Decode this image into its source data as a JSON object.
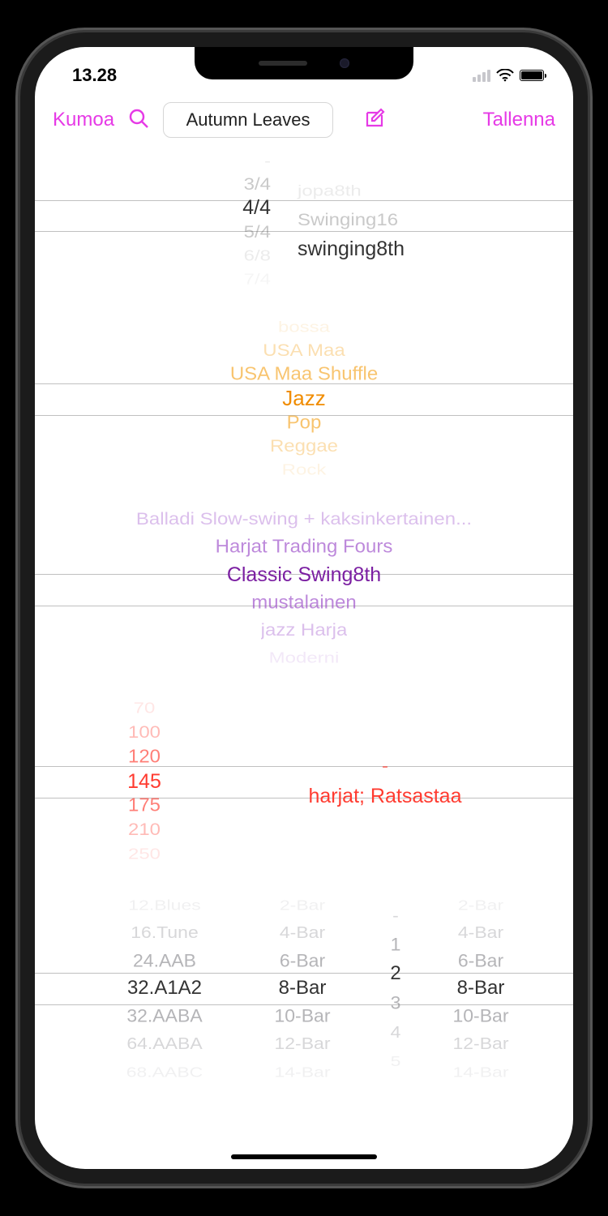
{
  "statusbar": {
    "time": "13.28"
  },
  "toolbar": {
    "cancel": "Kumoa",
    "title": "Autumn Leaves",
    "save": "Tallenna"
  },
  "picker1": {
    "col1": {
      "a3": "-",
      "a2": "3/4",
      "sel": "4/4",
      "b1": "5/4",
      "b2": "6/8",
      "b3": "7/4"
    },
    "col2": {
      "a3": "jopa8th",
      "a2": "Swinging16",
      "sel": "swinging8th"
    }
  },
  "picker2": {
    "a3": "bossa",
    "a2": "USA Maa",
    "a1": "USA Maa Shuffle",
    "sel": "Jazz",
    "b1": "Pop",
    "b2": "Reggae",
    "b3": "Rock"
  },
  "picker3": {
    "a2": "Balladi Slow-swing + kaksinkertainen...",
    "a1": "Harjat Trading Fours",
    "sel": "Classic Swing8th",
    "b1": "mustalainen",
    "b2": "jazz Harja",
    "b3": "Moderni"
  },
  "picker4": {
    "col1": {
      "a3": "70",
      "a2": "100",
      "a1": "120",
      "sel": "145",
      "b1": "175",
      "b2": "210",
      "b3": "250"
    },
    "col2": {
      "a1": "-",
      "sel": "harjat; Ratsastaa"
    }
  },
  "picker5": {
    "c1": {
      "a3": "12.Blues",
      "a2": "16.Tune",
      "a1": "24.AAB",
      "sel": "32.A1A2",
      "b1": "32.AABA",
      "b2": "64.AABA",
      "b3": "68.AABC"
    },
    "c2": {
      "a3": "2-Bar",
      "a2": "4-Bar",
      "a1": "6-Bar",
      "sel": "8-Bar",
      "b1": "10-Bar",
      "b2": "12-Bar",
      "b3": "14-Bar"
    },
    "c3": {
      "a2": "-",
      "a1": "1",
      "sel": "2",
      "b1": "3",
      "b2": "4",
      "b3": "5"
    },
    "c4": {
      "a3": "2-Bar",
      "a2": "4-Bar",
      "a1": "6-Bar",
      "sel": "8-Bar",
      "b1": "10-Bar",
      "b2": "12-Bar",
      "b3": "14-Bar"
    }
  }
}
